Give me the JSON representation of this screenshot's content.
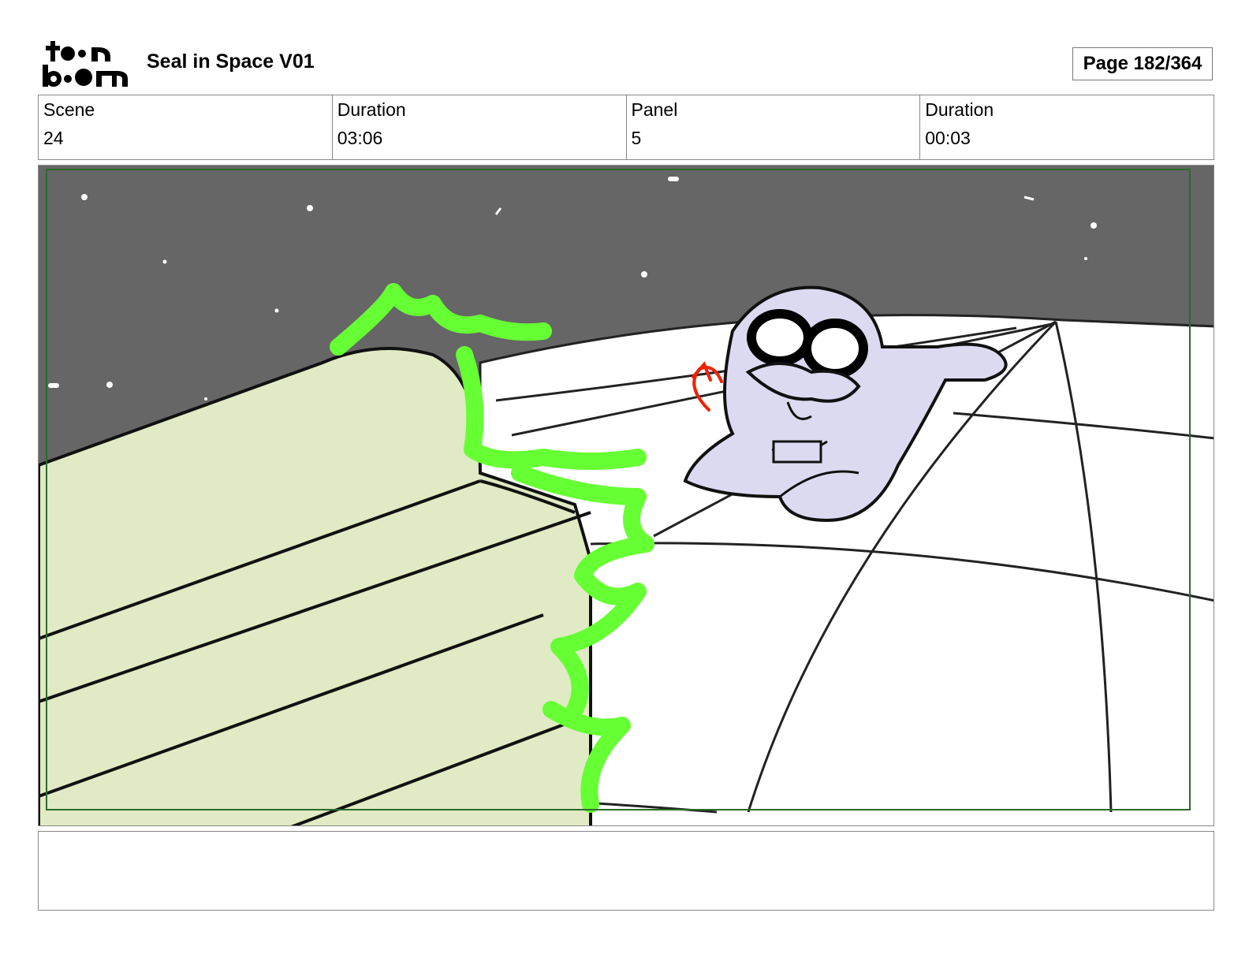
{
  "header": {
    "title": "Seal in Space V01",
    "page": "Page 182/364",
    "logo_text": "toonboom"
  },
  "info": {
    "scene_label": "Scene",
    "scene_value": "24",
    "duration_label": "Duration",
    "duration_value": "03:06",
    "panel_label": "Panel",
    "panel_value": "5",
    "panel_duration_label": "Duration",
    "panel_duration_value": "00:03"
  },
  "notes": {
    "text": ""
  },
  "colors": {
    "sky": "#666666",
    "ground": "#ffffff",
    "ramp": "#e0eac4",
    "glow": "#66ff33",
    "seal": "#dcdaf0",
    "arrow": "#ee2200",
    "safe_frame": "#2b6b2b"
  }
}
